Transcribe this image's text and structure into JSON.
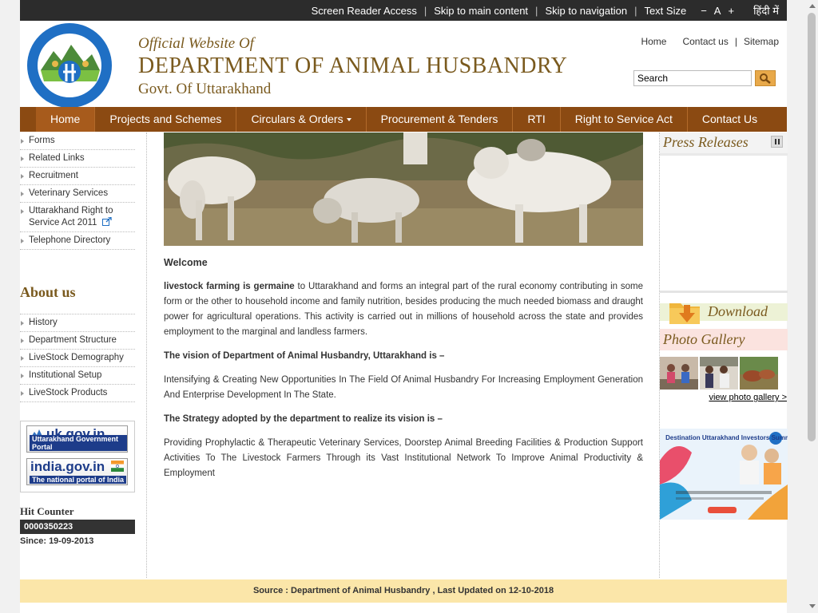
{
  "topbar": {
    "screen_reader": "Screen Reader Access",
    "skip_main": "Skip to main content",
    "skip_nav": "Skip to navigation",
    "text_size": "Text Size",
    "decrease": "−",
    "normal": "A",
    "increase": "+",
    "hindi": "हिंदी में"
  },
  "header": {
    "official": "Official Website Of",
    "dept": "DEPARTMENT OF ANIMAL HUSBANDRY",
    "govt": "Govt. Of Uttarakhand",
    "links": {
      "home": "Home",
      "contact": "Contact us",
      "sitemap": "Sitemap"
    },
    "search_value": "Search"
  },
  "nav": [
    "Home",
    "Projects and Schemes",
    "Circulars & Orders",
    "Procurement & Tenders",
    "RTI",
    "Right to Service Act",
    "Contact Us"
  ],
  "left": {
    "menu1": [
      "Forms",
      "Related Links",
      "Recruitment",
      "Veterinary Services",
      "Uttarakhand Right to Service Act 2011",
      "Telephone Directory"
    ],
    "about_title": "About us",
    "menu2": [
      "History",
      "Department Structure",
      "LiveStock Demography",
      "Institutional Setup",
      "LiveStock Products"
    ],
    "portal_uk": {
      "big": "uk.gov.in",
      "small": "Uttarakhand Government Portal"
    },
    "portal_india": {
      "big": "india.gov.in",
      "small": "The national portal of India"
    },
    "hit_title": "Hit Counter",
    "hit_value": "0000350223",
    "since": "Since: 19-09-2013"
  },
  "main": {
    "welcome": "Welcome",
    "p1_bold": "livestock farming is germaine",
    "p1_rest": " to Uttarakhand and forms an integral part of the rural economy contributing in some form or the other to household income and family nutrition, besides producing the much needed biomass and draught power for agricultural operations. This activity is carried out in millions of household across the state and provides employment to the marginal and landless farmers.",
    "vision_head": "The vision of Department of Animal Husbandry, Uttarakhand is –",
    "vision_text": "Intensifying & Creating New Opportunities In The Field Of Animal Husbandry For Increasing Employment Generation And Enterprise Development In The State.",
    "strategy_head": "The Strategy adopted by the department to realize its vision is –",
    "strategy_text": "Providing Prophylactic & Therapeutic Veterinary Services, Doorstep Animal Breeding Facilities & Production Support Activities To The Livestock Farmers Through its Vast Institutional Network To Improve Animal Productivity & Employment"
  },
  "right": {
    "press": "Press Releases",
    "download": "Download",
    "photo": "Photo Gallery",
    "gallery_link": "view photo gallery >",
    "summit_title": "Destination Uttarakhand Investors Summit"
  },
  "footer": {
    "text": "Source : Department of Animal Husbandry , Last Updated on 12-10-2018"
  },
  "colors": {
    "nav": "#8b4a12",
    "title": "#7a5a1e",
    "footer": "#fbe6a9",
    "topbar": "#2c2c2c"
  }
}
